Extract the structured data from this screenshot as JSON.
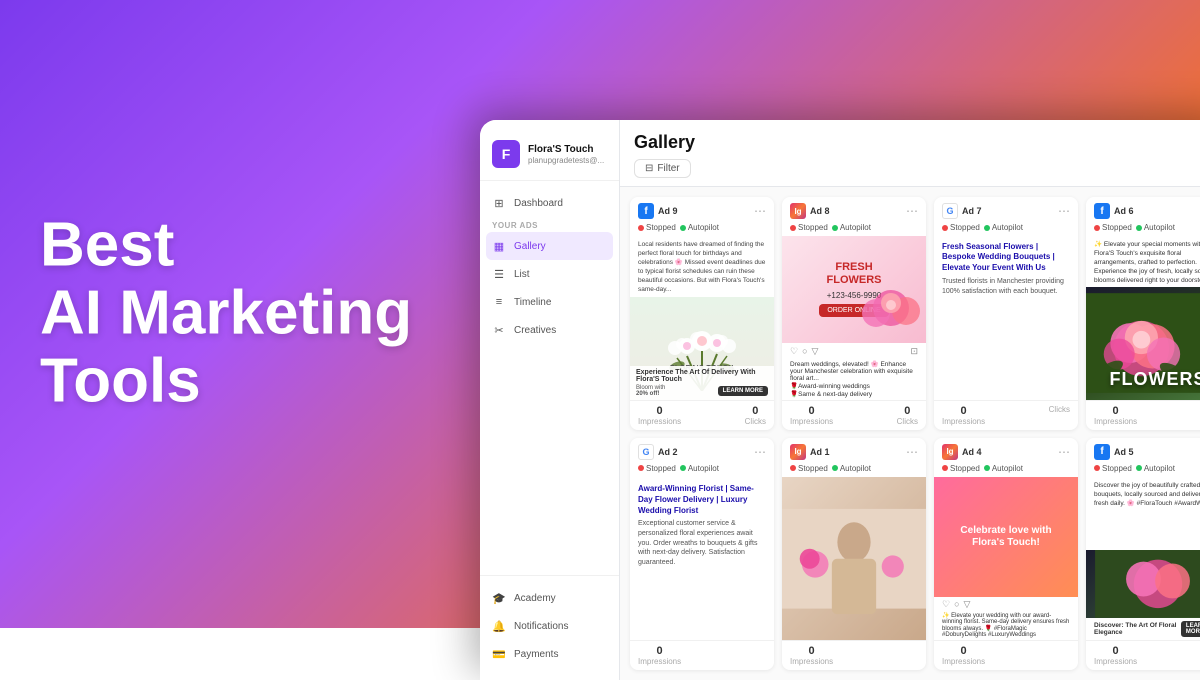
{
  "hero": {
    "line1": "Best",
    "line2": "AI Marketing",
    "line3": "Tools"
  },
  "sidebar": {
    "brand": {
      "name": "Flora'S Touch",
      "sub": "planupgradetests@..."
    },
    "nav_label": "YOUR ADS",
    "items": [
      {
        "id": "dashboard",
        "label": "Dashboard",
        "icon": "⊞",
        "active": false
      },
      {
        "id": "gallery",
        "label": "Gallery",
        "icon": "🖼",
        "active": true
      },
      {
        "id": "list",
        "label": "List",
        "icon": "☰",
        "active": false
      },
      {
        "id": "timeline",
        "label": "Timeline",
        "icon": "≡",
        "active": false
      },
      {
        "id": "creatives",
        "label": "Creatives",
        "icon": "✂",
        "active": false
      }
    ],
    "bottom_items": [
      {
        "id": "academy",
        "label": "Academy",
        "icon": "🎓"
      },
      {
        "id": "notifications",
        "label": "Notifications",
        "icon": "🔔"
      },
      {
        "id": "payments",
        "label": "Payments",
        "icon": "💳"
      }
    ]
  },
  "main": {
    "title": "Gallery",
    "filter_label": "Filter"
  },
  "ads": [
    {
      "id": "ad9",
      "num": "Ad 9",
      "platform": "facebook",
      "platform_label": "f",
      "status_stopped": "Stopped",
      "status_autopilot": "Autopilot",
      "text": "Local residents have dreamed of finding the perfect floral touch for birthdays and celebrations 🌸 Missed event deadlines due to typical florist schedules can ruin these beautiful occasions. But with Flora's Touch's same-day...",
      "overlay_text": "Experience The Art Of Delivery With Flora'S Touch",
      "cta": "LEARN MORE",
      "bg_type": "bouquet",
      "impressions": "0",
      "clicks": "0",
      "impressions_label": "Impressions",
      "clicks_label": "Clicks"
    },
    {
      "id": "ad8",
      "num": "Ad 8",
      "platform": "instagram",
      "platform_label": "I",
      "status_stopped": "Stopped",
      "status_autopilot": "Autopilot",
      "fresh_title": "FRESH FLOWERS",
      "phone": "+123-456-9990",
      "order_label": "ORDER ONLINE",
      "action_icons": "♡ ○ ▽",
      "caption": "Dream weddings, elevated! 🌸 Enhance your Manchester celebration with exquisite floral art...\n🌹Award-winning weddings\n🌹Same & next-day delivery",
      "impressions": "0",
      "clicks": "0",
      "impressions_label": "Impressions",
      "clicks_label": "Clicks"
    },
    {
      "id": "ad7",
      "num": "Ad 7",
      "platform": "google",
      "platform_label": "G",
      "status_stopped": "Stopped",
      "status_autopilot": "Autopilot",
      "title_text": "Fresh Seasonal Flowers | Bespoke Wedding Bouquets | Elevate Your Event With Us",
      "desc_text": "Trusted florists in Manchester providing 100% satisfaction with each bouquet.",
      "impressions": "0",
      "impressions_label": "Impressions",
      "clicks": "Clicks"
    },
    {
      "id": "ad6",
      "num": "Ad 6",
      "platform": "facebook",
      "platform_label": "f",
      "status_stopped": "Stopped",
      "status_autopilot": "Autopilot",
      "flowers_text": "FLOWERS",
      "impressions": "0",
      "impressions_label": "Impressions"
    },
    {
      "id": "ad2",
      "num": "Ad 2",
      "platform": "google",
      "platform_label": "G",
      "status_stopped": "Stopped",
      "status_autopilot": "Autopilot",
      "title_text": "Award-Winning Florist | Same-Day Flower Delivery | Luxury Wedding Florist",
      "desc_text": "Exceptional customer service & personalized floral experiences await you. Order wreaths to bouquets & gifts with next-day delivery. Satisfaction guaranteed.",
      "impressions": "0",
      "impressions_label": "Impressions"
    },
    {
      "id": "ad1",
      "num": "Ad 1",
      "platform": "instagram",
      "platform_label": "I",
      "status_stopped": "Stopped",
      "status_autopilot": "Autopilot",
      "impressions": "0",
      "impressions_label": "Impressions"
    },
    {
      "id": "ad4",
      "num": "Ad 4",
      "platform": "instagram",
      "platform_label": "I",
      "status_stopped": "Stopped",
      "status_autopilot": "Autopilot",
      "celebrate_title": "Celebrate love with Flora's Touch!",
      "action_icons": "♡ ○ ▽",
      "caption": "✨ Elevate your wedding with our award-winning florist. Same-day delivery ensures fresh blooms always. 🌹 #FloraMagic #DoburyDelights #LuxuryWeddings",
      "impressions": "0",
      "impressions_label": "Impressions"
    }
  ],
  "colors": {
    "purple": "#7c3aed",
    "accent": "#f97316",
    "stopped": "#ef4444",
    "autopilot": "#22c55e",
    "google_blue": "#1a0dab",
    "facebook_blue": "#1877f2"
  }
}
